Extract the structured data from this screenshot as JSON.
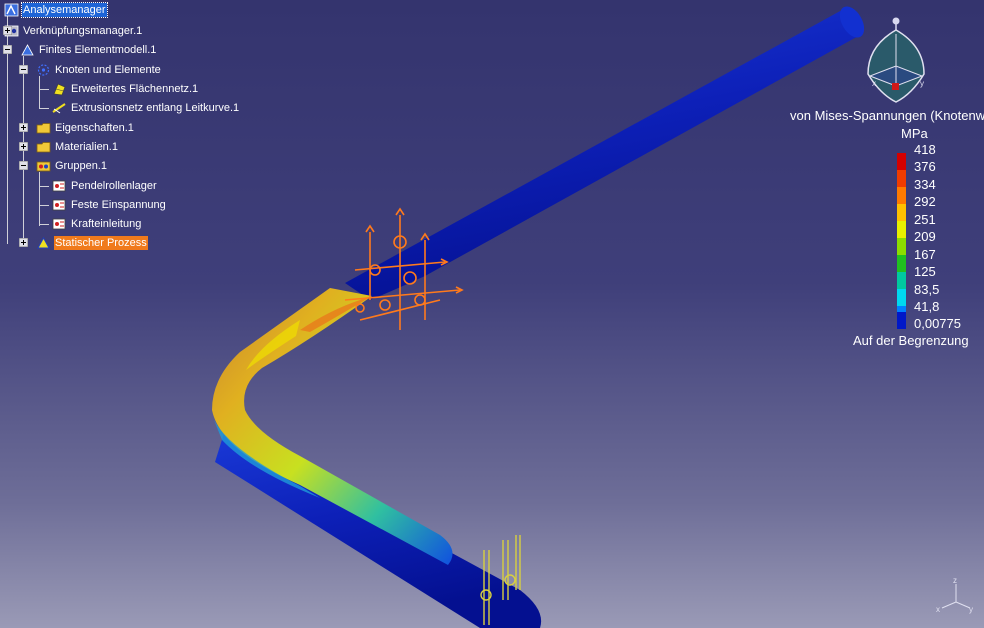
{
  "tree": {
    "items": [
      {
        "label": "Analysemanager",
        "icon": "analysis-manager-icon"
      },
      {
        "label": "Verknüpfungsmanager.1",
        "icon": "links-manager-icon"
      },
      {
        "label": "Finites Elementmodell.1",
        "icon": "finite-element-model-icon"
      },
      {
        "label": "Knoten und Elemente",
        "icon": "nodes-elements-icon"
      },
      {
        "label": "Erweitertes Flächennetz.1",
        "icon": "surface-mesh-icon"
      },
      {
        "label": "Extrusionsnetz entlang Leitkurve.1",
        "icon": "extrusion-mesh-icon"
      },
      {
        "label": "Eigenschaften.1",
        "icon": "folder-icon"
      },
      {
        "label": "Materialien.1",
        "icon": "folder-icon"
      },
      {
        "label": "Gruppen.1",
        "icon": "groups-icon"
      },
      {
        "label": "Pendelrollenlager",
        "icon": "group-item-icon"
      },
      {
        "label": "Feste Einspannung",
        "icon": "group-item-icon"
      },
      {
        "label": "Krafteinleitung",
        "icon": "group-item-icon"
      },
      {
        "label": "Statischer Prozess",
        "icon": "static-process-icon"
      }
    ]
  },
  "legend": {
    "title": "von Mises-Spannungen (Knotenwerte)",
    "unit": "MPa",
    "entries": [
      {
        "value": "418",
        "color": "#d40000"
      },
      {
        "value": "376",
        "color": "#f03c00"
      },
      {
        "value": "334",
        "color": "#ff7a00"
      },
      {
        "value": "292",
        "color": "#ffc000"
      },
      {
        "value": "251",
        "color": "#e8f000"
      },
      {
        "value": "209",
        "color": "#8cdc00"
      },
      {
        "value": "167",
        "color": "#20c020"
      },
      {
        "value": "125",
        "color": "#00c8a0"
      },
      {
        "value": "83,5",
        "color": "#00d8f0"
      },
      {
        "value": "41,8",
        "color": "#0080ff"
      },
      {
        "value": "0,00775",
        "color": "#0018c8"
      }
    ],
    "footer": "Auf der Begrenzung"
  },
  "compass": {
    "axis_labels": [
      "x",
      "y",
      "z"
    ]
  },
  "colors": {
    "background_top": "#34346e",
    "background_bottom": "#9a9ab6",
    "selection": "#1e64d6",
    "highlight": "#f07a1c"
  }
}
